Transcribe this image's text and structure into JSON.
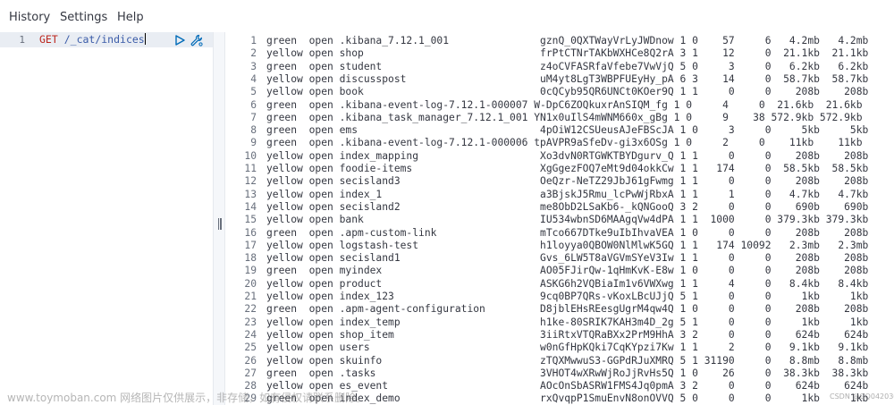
{
  "menu": {
    "history": "History",
    "settings": "Settings",
    "help": "Help"
  },
  "editor": {
    "line_number": "1",
    "method": "GET",
    "path": "/_cat/indices"
  },
  "output_lines": [
    [
      "1",
      "green  open .kibana_7.12.1_001               gznQ_0QXTWayVrLyJWDnow 1 0    57     6   4.2mb   4.2mb"
    ],
    [
      "2",
      "yellow open shop                             frPtCTNrTAKbWXHCe8Q2rA 3 1    12     0  21.1kb  21.1kb"
    ],
    [
      "3",
      "green  open student                          z4oCVFASRfaVfebe7VwVjQ 5 0     3     0   6.2kb   6.2kb"
    ],
    [
      "4",
      "yellow open discusspost                      uM4yt8LgT3WBPFUEyHy_pA 6 3    14     0  58.7kb  58.7kb"
    ],
    [
      "5",
      "yellow open book                             0cQCyb95QR6UNCt0KOer9Q 1 1     0     0    208b    208b"
    ],
    [
      "6",
      "green  open .kibana-event-log-7.12.1-000007 W-DpC6ZOQkuxrAnSIQM_fg 1 0     4     0  21.6kb  21.6kb"
    ],
    [
      "7",
      "green  open .kibana_task_manager_7.12.1_001 YN1x0uIlS4mWNM660x_gBg 1 0     9    38 572.9kb 572.9kb"
    ],
    [
      "8",
      "green  open ems                              4pOiW12CSUeusAJeFBScJA 1 0     3     0     5kb     5kb"
    ],
    [
      "9",
      "green  open .kibana-event-log-7.12.1-000006 tpAVPR9aSfeDv-gi3x6OSg 1 0     2     0    11kb    11kb"
    ],
    [
      "10",
      "yellow open index_mapping                    Xo3dvN0RTGWKTBYDgurv_Q 1 1     0     0    208b    208b"
    ],
    [
      "11",
      "yellow open foodie-items                     XgGgezFOQ7eMt9d04okkCw 1 1   174     0  58.5kb  58.5kb"
    ],
    [
      "12",
      "yellow open secisland3                       OeQzr-NeTZ29JbJ61gFwmg 1 1     0     0    208b    208b"
    ],
    [
      "13",
      "yellow open index_1                          a3BjskJ5Rmu_lcPwWjRbxA 1 1     1     0   4.7kb   4.7kb"
    ],
    [
      "14",
      "yellow open secisland2                       me8ObD2LSaKb6-_kQNGooQ 3 2     0     0    690b    690b"
    ],
    [
      "15",
      "yellow open bank                             IU534wbnSD6MAAgqVw4dPA 1 1  1000     0 379.3kb 379.3kb"
    ],
    [
      "16",
      "green  open .apm-custom-link                 mTco667DTke9uIbIhvaVEA 1 0     0     0    208b    208b"
    ],
    [
      "17",
      "yellow open logstash-test                    h1loyya0QBOW0NlMlwK5GQ 1 1   174 10092   2.3mb   2.3mb"
    ],
    [
      "18",
      "yellow open secisland1                       Gvs_6LW5T8aVGVmSYeV3Iw 1 1     0     0    208b    208b"
    ],
    [
      "19",
      "green  open myindex                          AO05FJirQw-1qHmKvK-E8w 1 0     0     0    208b    208b"
    ],
    [
      "20",
      "yellow open product                          ASKG6h2VQBiaIm1v6VWXwg 1 1     4     0   8.4kb   8.4kb"
    ],
    [
      "21",
      "yellow open index_123                        9cq0BP7QRs-vKoxLBcUJjQ 5 1     0     0     1kb     1kb"
    ],
    [
      "22",
      "green  open .apm-agent-configuration         D8jblEHsREesgUgrM4qw4Q 1 0     0     0    208b    208b"
    ],
    [
      "23",
      "yellow open index_temp                       h1ke-80SRIK7KAH3m4D_2g 5 1     0     0     1kb     1kb"
    ],
    [
      "24",
      "yellow open shop_item                        3iiRtxVTQRaBXx2PrM9HhA 3 2     0     0    624b    624b"
    ],
    [
      "25",
      "yellow open users                            w0nGfHpKQki7CqKYpzi7Kw 1 1     2     0   9.1kb   9.1kb"
    ],
    [
      "26",
      "yellow open skuinfo                          zTQXMwwuS3-GGPdRJuXMRQ 5 1 31190     0   8.8mb   8.8mb"
    ],
    [
      "27",
      "green  open .tasks                           3VHOT4wXRwWjRoJjRvHs5Q 1 0    26     0  38.3kb  38.3kb"
    ],
    [
      "28",
      "yellow open es_event                         AOcOnSbASRW1FMS4Jq0pmA 3 2     0     0    624b    624b"
    ],
    [
      "29",
      "green  open index_demo                       rxQvqpP1SmuEnvN8onOVVQ 5 0     0     0     1kb     1kb"
    ]
  ],
  "watermark": "www.toymoban.com 网络图片仅供展示，非存储，如有侵权请联系删除。",
  "watermark_corner": "CSDN @GQ042030",
  "icons": {
    "run": "play-icon",
    "settings": "wrench-icon"
  },
  "colors": {
    "method": "#bd271e",
    "path": "#3a5ba8",
    "highlight_number": "#0f6ea8",
    "action_icon": "#006bb8"
  }
}
